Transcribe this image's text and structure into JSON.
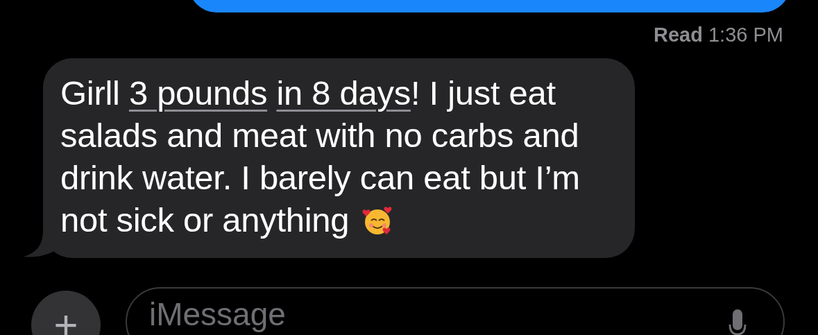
{
  "sent_bubble": {
    "kind": "outgoing"
  },
  "read_receipt": "**Read** 1:36 PM",
  "message": {
    "kind": "incoming",
    "segments": [
      {
        "text": "Girll ",
        "link": false
      },
      {
        "text": "3 pounds ",
        "link": true
      },
      {
        "text": "in 8 days",
        "link": true
      },
      {
        "text": "! I just eat salads and meat with no carbs and drink water. I barely can eat but I’m not sick or anything ",
        "link": false
      }
    ]
  },
  "composer": {
    "plus": "+",
    "placeholder": "iMessage"
  }
}
